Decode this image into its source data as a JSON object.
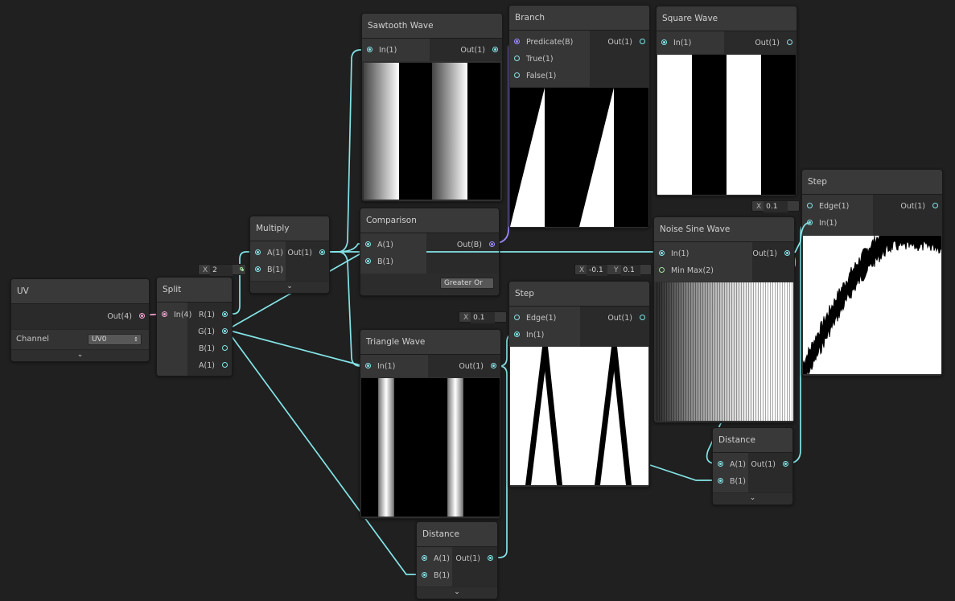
{
  "colors": {
    "background": "#202020",
    "wire_float": "#84e4e7",
    "wire_vector4": "#f2a5d3",
    "wire_bool": "#9c8bff",
    "wire_vector2": "#9ee49a"
  },
  "icons": {
    "expand": "chevron-down-icon",
    "select_arrows": "updown-arrows-icon",
    "port": "port-dot-icon"
  },
  "uv": {
    "title": "UV",
    "out": "Out(4)",
    "channel_label": "Channel",
    "channel_value": "UV0"
  },
  "split": {
    "title": "Split",
    "in": "In(4)",
    "r": "R(1)",
    "g": "G(1)",
    "b": "B(1)",
    "a": "A(1)"
  },
  "multiply": {
    "title": "Multiply",
    "a": "A(1)",
    "b": "B(1)",
    "out": "Out(1)",
    "b_field_label": "X",
    "b_field_value": "2"
  },
  "sawtooth": {
    "title": "Sawtooth Wave",
    "in": "In(1)",
    "out": "Out(1)"
  },
  "branch": {
    "title": "Branch",
    "predicate": "Predicate(B)",
    "true_in": "True(1)",
    "false_in": "False(1)",
    "out": "Out(1)"
  },
  "square": {
    "title": "Square Wave",
    "in": "In(1)",
    "out": "Out(1)"
  },
  "step_top": {
    "title": "Step",
    "edge": "Edge(1)",
    "in": "In(1)",
    "out": "Out(1)",
    "edge_field_label": "X",
    "edge_field_value": "0.1"
  },
  "comparison": {
    "title": "Comparison",
    "a": "A(1)",
    "b": "B(1)",
    "out": "Out(B)",
    "mode": "Greater Or Equ"
  },
  "noise_sine": {
    "title": "Noise Sine Wave",
    "in": "In(1)",
    "minmax": "Min Max(2)",
    "out": "Out(1)",
    "x_label": "X",
    "x_value": "-0.1",
    "y_label": "Y",
    "y_value": "0.1"
  },
  "step_mid": {
    "title": "Step",
    "edge": "Edge(1)",
    "in": "In(1)",
    "out": "Out(1)",
    "edge_field_label": "X",
    "edge_field_value": "0.1"
  },
  "triangle": {
    "title": "Triangle Wave",
    "in": "In(1)",
    "out": "Out(1)"
  },
  "distance_right": {
    "title": "Distance",
    "a": "A(1)",
    "b": "B(1)",
    "out": "Out(1)"
  },
  "distance_bottom": {
    "title": "Distance",
    "a": "A(1)",
    "b": "B(1)",
    "out": "Out(1)"
  }
}
